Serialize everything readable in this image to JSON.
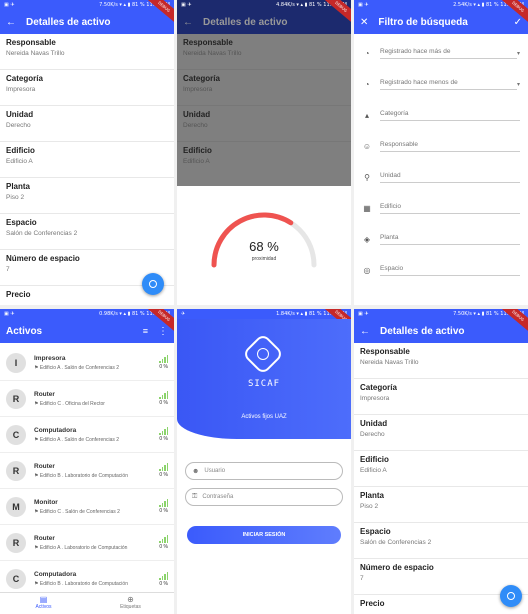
{
  "status_1": {
    "speed": "7.50K/s",
    "battery": "81 %",
    "time": "11:36 AM"
  },
  "status_2": {
    "speed": "4.84K/s",
    "battery": "81 %",
    "time": "11:36 AM"
  },
  "status_3": {
    "speed": "2.54K/s",
    "battery": "81 %",
    "time": "11:36 AM"
  },
  "status_4": {
    "speed": "0.98K/s",
    "battery": "81 %",
    "time": "11:36 AM"
  },
  "status_5": {
    "speed": "1.84K/s",
    "battery": "81 %",
    "time": "11:36 AM"
  },
  "status_6": {
    "speed": "7.50K/s",
    "battery": "81 %",
    "time": "11:36 AM"
  },
  "debug_label": "DEBUG",
  "detail": {
    "title": "Detalles de activo",
    "fields": [
      {
        "label": "Responsable",
        "value": "Nereida Navas Trillo"
      },
      {
        "label": "Categoría",
        "value": "Impresora"
      },
      {
        "label": "Unidad",
        "value": "Derecho"
      },
      {
        "label": "Edificio",
        "value": "Edificio A"
      },
      {
        "label": "Planta",
        "value": "Piso 2"
      },
      {
        "label": "Espacio",
        "value": "Salón de Conferencias 2"
      },
      {
        "label": "Número de espacio",
        "value": "7"
      },
      {
        "label": "Precio",
        "value": ""
      }
    ]
  },
  "proximity": {
    "percent_label": "68 %",
    "caption": "proximidad",
    "value": 0.68
  },
  "filter": {
    "title": "Filtro de búsqueda",
    "items": [
      {
        "icon": "clock-icon",
        "label": "Registrado hace más de",
        "dropdown": true
      },
      {
        "icon": "clock-icon",
        "label": "Registrado hace menos de",
        "dropdown": true
      },
      {
        "icon": "category-icon",
        "label": "Categoría"
      },
      {
        "icon": "person-icon",
        "label": "Responsable"
      },
      {
        "icon": "pin-icon",
        "label": "Unidad"
      },
      {
        "icon": "building-icon",
        "label": "Edificio"
      },
      {
        "icon": "layers-icon",
        "label": "Planta"
      },
      {
        "icon": "target-icon",
        "label": "Espacio"
      }
    ]
  },
  "assets": {
    "title": "Activos",
    "items": [
      {
        "initial": "I",
        "name": "Impresora",
        "location": "Edificio A . Salón de Conferencias 2",
        "signal": "0 %"
      },
      {
        "initial": "R",
        "name": "Router",
        "location": "Edificio C . Oficina del Rector",
        "signal": "0 %"
      },
      {
        "initial": "C",
        "name": "Computadora",
        "location": "Edificio A . Salón de Conferencias 2",
        "signal": "0 %"
      },
      {
        "initial": "R",
        "name": "Router",
        "location": "Edificio B . Laboratorio de Computación",
        "signal": "0 %"
      },
      {
        "initial": "M",
        "name": "Monitor",
        "location": "Edificio C . Salón de Conferencias 2",
        "signal": "0 %"
      },
      {
        "initial": "R",
        "name": "Router",
        "location": "Edificio A . Laboratorio de Computación",
        "signal": "0 %"
      },
      {
        "initial": "C",
        "name": "Computadora",
        "location": "Edificio B . Laboratorio de Computación",
        "signal": "0 %"
      }
    ],
    "nav": [
      {
        "label": "Activos",
        "active": true
      },
      {
        "label": "Etiquetas",
        "active": false
      }
    ]
  },
  "login": {
    "brand": "SICAF",
    "subtitle": "Activos fijos UAZ",
    "user_placeholder": "Usuario",
    "pass_placeholder": "Contraseña",
    "button": "INICIAR SESIÓN"
  }
}
